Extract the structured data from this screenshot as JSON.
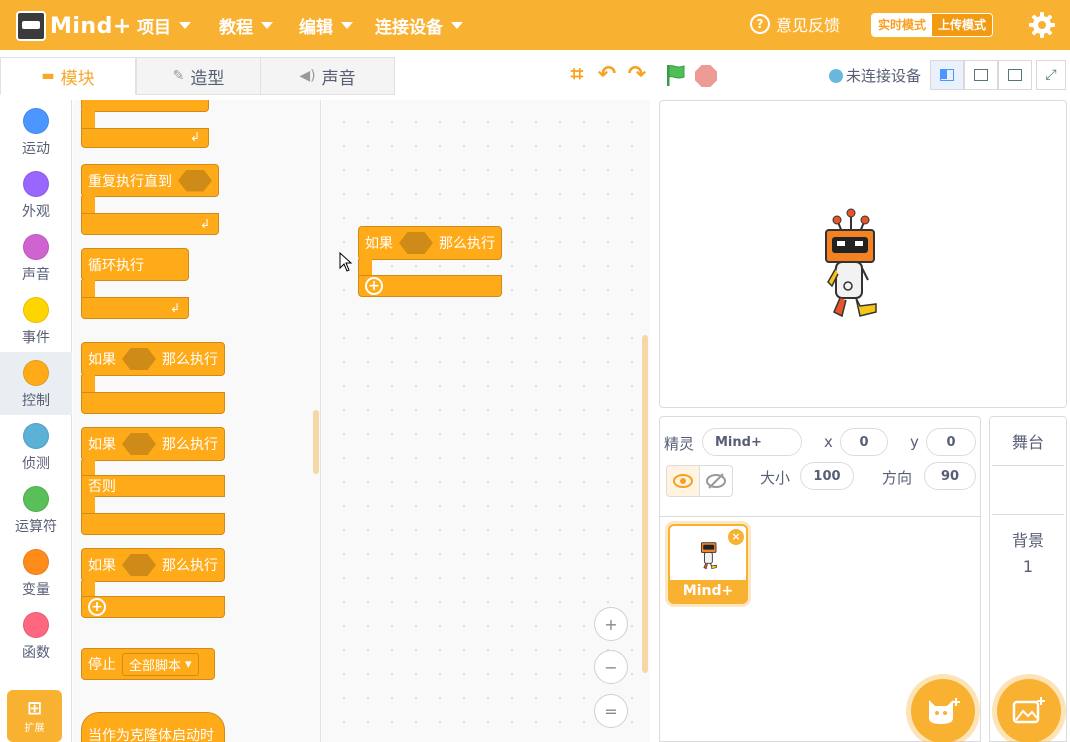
{
  "app": {
    "logo_text": "Mind+"
  },
  "menu": [
    {
      "label": "项目"
    },
    {
      "label": "教程"
    },
    {
      "label": "编辑"
    },
    {
      "label": "连接设备"
    }
  ],
  "header": {
    "feedback_label": "意见反馈",
    "mode_live": "实时模式",
    "mode_upload": "上传模式"
  },
  "tabs": [
    {
      "label": "模块",
      "icon": "blocks-icon",
      "active": true
    },
    {
      "label": "造型",
      "icon": "brush-icon",
      "active": false
    },
    {
      "label": "声音",
      "icon": "speaker-icon",
      "active": false
    }
  ],
  "toolbar": {
    "device_status": "未连接设备"
  },
  "categories": [
    {
      "label": "运动",
      "color": "#4c97ff"
    },
    {
      "label": "外观",
      "color": "#9966ff"
    },
    {
      "label": "声音",
      "color": "#cf63cf"
    },
    {
      "label": "事件",
      "color": "#ffd500"
    },
    {
      "label": "控制",
      "color": "#ffab19",
      "active": true
    },
    {
      "label": "侦测",
      "color": "#5cb1d6"
    },
    {
      "label": "运算符",
      "color": "#59c059"
    },
    {
      "label": "变量",
      "color": "#ff8c1a"
    },
    {
      "label": "函数",
      "color": "#ff6680"
    }
  ],
  "extensions": {
    "label": "扩展"
  },
  "palette": {
    "repeat_until": "重复执行直到",
    "forever": "循环执行",
    "if1_if": "如果",
    "if1_then": "那么执行",
    "if2_if": "如果",
    "if2_then": "那么执行",
    "if2_else": "否则",
    "if3_if": "如果",
    "if3_then": "那么执行",
    "stop": "停止",
    "stop_option": "全部脚本",
    "clone_start": "当作为克隆体启动时"
  },
  "script_block": {
    "if": "如果",
    "then": "那么执行"
  },
  "zoom": {
    "in": "+",
    "out": "−",
    "reset": "="
  },
  "sprite_info": {
    "sprite_label": "精灵",
    "sprite_name": "Mind+",
    "x_label": "x",
    "x_value": "0",
    "y_label": "y",
    "y_value": "0",
    "size_label": "大小",
    "size_value": "100",
    "direction_label": "方向",
    "direction_value": "90"
  },
  "sprite_list": [
    {
      "name": "Mind+"
    }
  ],
  "stage_pane": {
    "title": "舞台",
    "backdrop_label": "背景",
    "backdrop_count": "1"
  },
  "colors": {
    "accent": "#f9b132",
    "control": "#ffab19",
    "control_dark": "#cf8b17",
    "flag": "#4cbf56",
    "stop": "#ec9b95"
  }
}
